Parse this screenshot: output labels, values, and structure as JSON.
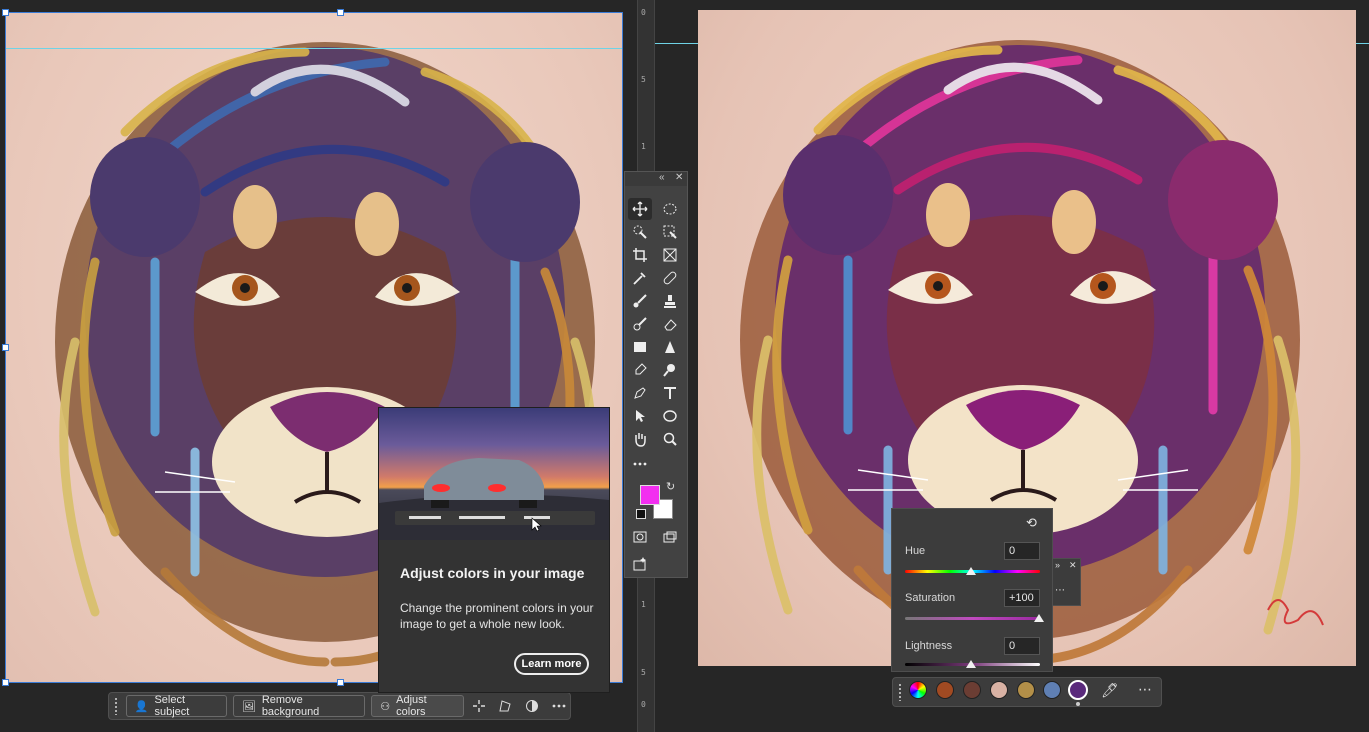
{
  "contextual_bar": {
    "select_subject": "Select subject",
    "remove_background": "Remove background",
    "adjust_colors": "Adjust colors"
  },
  "tooltip": {
    "title": "Adjust colors in your image",
    "body": "Change the prominent colors in your image to get a whole new look.",
    "learn_more": "Learn more"
  },
  "hsl_panel": {
    "hue_label": "Hue",
    "hue_value": "0",
    "saturation_label": "Saturation",
    "saturation_value": "+100",
    "lightness_label": "Lightness",
    "lightness_value": "0"
  },
  "color_swatches": [
    "#a14a22",
    "#6b3d33",
    "#d9b2a4",
    "#b38f48",
    "#5f7fb3",
    "#5a2a7c"
  ],
  "foreground_color": "#f22ef0",
  "background_color": "#ffffff",
  "ruler": {
    "ticks": [
      "0",
      "5",
      "1",
      "1",
      "5",
      "0"
    ]
  },
  "toolbar_icons": [
    "move-icon",
    "elliptical-marquee-icon",
    "quick-selection-icon",
    "object-selection-icon",
    "crop-icon",
    "frame-icon",
    "eyedropper-icon",
    "spot-healing-icon",
    "brush-icon",
    "clone-stamp-icon",
    "history-brush-icon",
    "eraser-icon",
    "gradient-icon",
    "blur-icon",
    "dodge-icon",
    "smudge-icon",
    "pen-icon",
    "type-icon",
    "path-selection-icon",
    "ellipse-shape-icon",
    "hand-icon",
    "zoom-icon",
    "more-tools-icon",
    "quick-mask-icon",
    "screen-mode-icon",
    "generative-icon"
  ]
}
